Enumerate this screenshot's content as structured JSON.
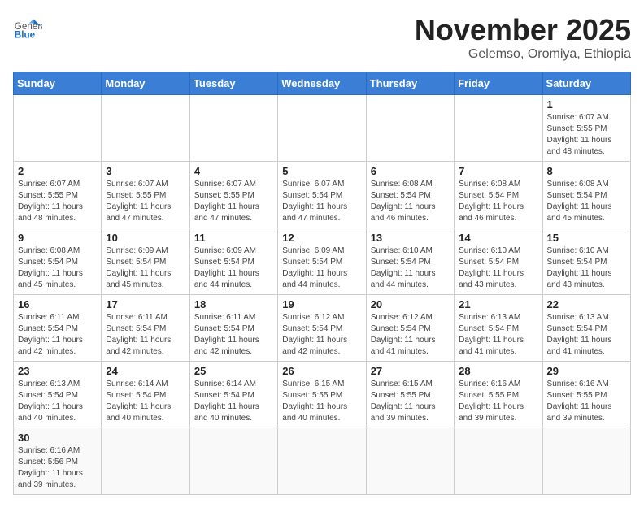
{
  "header": {
    "logo_general": "General",
    "logo_blue": "Blue",
    "title": "November 2025",
    "subtitle": "Gelemso, Oromiya, Ethiopia"
  },
  "days": [
    "Sunday",
    "Monday",
    "Tuesday",
    "Wednesday",
    "Thursday",
    "Friday",
    "Saturday"
  ],
  "weeks": [
    [
      {
        "day": "",
        "info": ""
      },
      {
        "day": "",
        "info": ""
      },
      {
        "day": "",
        "info": ""
      },
      {
        "day": "",
        "info": ""
      },
      {
        "day": "",
        "info": ""
      },
      {
        "day": "",
        "info": ""
      },
      {
        "day": "1",
        "info": "Sunrise: 6:07 AM\nSunset: 5:55 PM\nDaylight: 11 hours\nand 48 minutes."
      }
    ],
    [
      {
        "day": "2",
        "info": "Sunrise: 6:07 AM\nSunset: 5:55 PM\nDaylight: 11 hours\nand 48 minutes."
      },
      {
        "day": "3",
        "info": "Sunrise: 6:07 AM\nSunset: 5:55 PM\nDaylight: 11 hours\nand 47 minutes."
      },
      {
        "day": "4",
        "info": "Sunrise: 6:07 AM\nSunset: 5:55 PM\nDaylight: 11 hours\nand 47 minutes."
      },
      {
        "day": "5",
        "info": "Sunrise: 6:07 AM\nSunset: 5:54 PM\nDaylight: 11 hours\nand 47 minutes."
      },
      {
        "day": "6",
        "info": "Sunrise: 6:08 AM\nSunset: 5:54 PM\nDaylight: 11 hours\nand 46 minutes."
      },
      {
        "day": "7",
        "info": "Sunrise: 6:08 AM\nSunset: 5:54 PM\nDaylight: 11 hours\nand 46 minutes."
      },
      {
        "day": "8",
        "info": "Sunrise: 6:08 AM\nSunset: 5:54 PM\nDaylight: 11 hours\nand 45 minutes."
      }
    ],
    [
      {
        "day": "9",
        "info": "Sunrise: 6:08 AM\nSunset: 5:54 PM\nDaylight: 11 hours\nand 45 minutes."
      },
      {
        "day": "10",
        "info": "Sunrise: 6:09 AM\nSunset: 5:54 PM\nDaylight: 11 hours\nand 45 minutes."
      },
      {
        "day": "11",
        "info": "Sunrise: 6:09 AM\nSunset: 5:54 PM\nDaylight: 11 hours\nand 44 minutes."
      },
      {
        "day": "12",
        "info": "Sunrise: 6:09 AM\nSunset: 5:54 PM\nDaylight: 11 hours\nand 44 minutes."
      },
      {
        "day": "13",
        "info": "Sunrise: 6:10 AM\nSunset: 5:54 PM\nDaylight: 11 hours\nand 44 minutes."
      },
      {
        "day": "14",
        "info": "Sunrise: 6:10 AM\nSunset: 5:54 PM\nDaylight: 11 hours\nand 43 minutes."
      },
      {
        "day": "15",
        "info": "Sunrise: 6:10 AM\nSunset: 5:54 PM\nDaylight: 11 hours\nand 43 minutes."
      }
    ],
    [
      {
        "day": "16",
        "info": "Sunrise: 6:11 AM\nSunset: 5:54 PM\nDaylight: 11 hours\nand 42 minutes."
      },
      {
        "day": "17",
        "info": "Sunrise: 6:11 AM\nSunset: 5:54 PM\nDaylight: 11 hours\nand 42 minutes."
      },
      {
        "day": "18",
        "info": "Sunrise: 6:11 AM\nSunset: 5:54 PM\nDaylight: 11 hours\nand 42 minutes."
      },
      {
        "day": "19",
        "info": "Sunrise: 6:12 AM\nSunset: 5:54 PM\nDaylight: 11 hours\nand 42 minutes."
      },
      {
        "day": "20",
        "info": "Sunrise: 6:12 AM\nSunset: 5:54 PM\nDaylight: 11 hours\nand 41 minutes."
      },
      {
        "day": "21",
        "info": "Sunrise: 6:13 AM\nSunset: 5:54 PM\nDaylight: 11 hours\nand 41 minutes."
      },
      {
        "day": "22",
        "info": "Sunrise: 6:13 AM\nSunset: 5:54 PM\nDaylight: 11 hours\nand 41 minutes."
      }
    ],
    [
      {
        "day": "23",
        "info": "Sunrise: 6:13 AM\nSunset: 5:54 PM\nDaylight: 11 hours\nand 40 minutes."
      },
      {
        "day": "24",
        "info": "Sunrise: 6:14 AM\nSunset: 5:54 PM\nDaylight: 11 hours\nand 40 minutes."
      },
      {
        "day": "25",
        "info": "Sunrise: 6:14 AM\nSunset: 5:54 PM\nDaylight: 11 hours\nand 40 minutes."
      },
      {
        "day": "26",
        "info": "Sunrise: 6:15 AM\nSunset: 5:55 PM\nDaylight: 11 hours\nand 40 minutes."
      },
      {
        "day": "27",
        "info": "Sunrise: 6:15 AM\nSunset: 5:55 PM\nDaylight: 11 hours\nand 39 minutes."
      },
      {
        "day": "28",
        "info": "Sunrise: 6:16 AM\nSunset: 5:55 PM\nDaylight: 11 hours\nand 39 minutes."
      },
      {
        "day": "29",
        "info": "Sunrise: 6:16 AM\nSunset: 5:55 PM\nDaylight: 11 hours\nand 39 minutes."
      }
    ],
    [
      {
        "day": "30",
        "info": "Sunrise: 6:16 AM\nSunset: 5:56 PM\nDaylight: 11 hours\nand 39 minutes."
      },
      {
        "day": "",
        "info": ""
      },
      {
        "day": "",
        "info": ""
      },
      {
        "day": "",
        "info": ""
      },
      {
        "day": "",
        "info": ""
      },
      {
        "day": "",
        "info": ""
      },
      {
        "day": "",
        "info": ""
      }
    ]
  ]
}
